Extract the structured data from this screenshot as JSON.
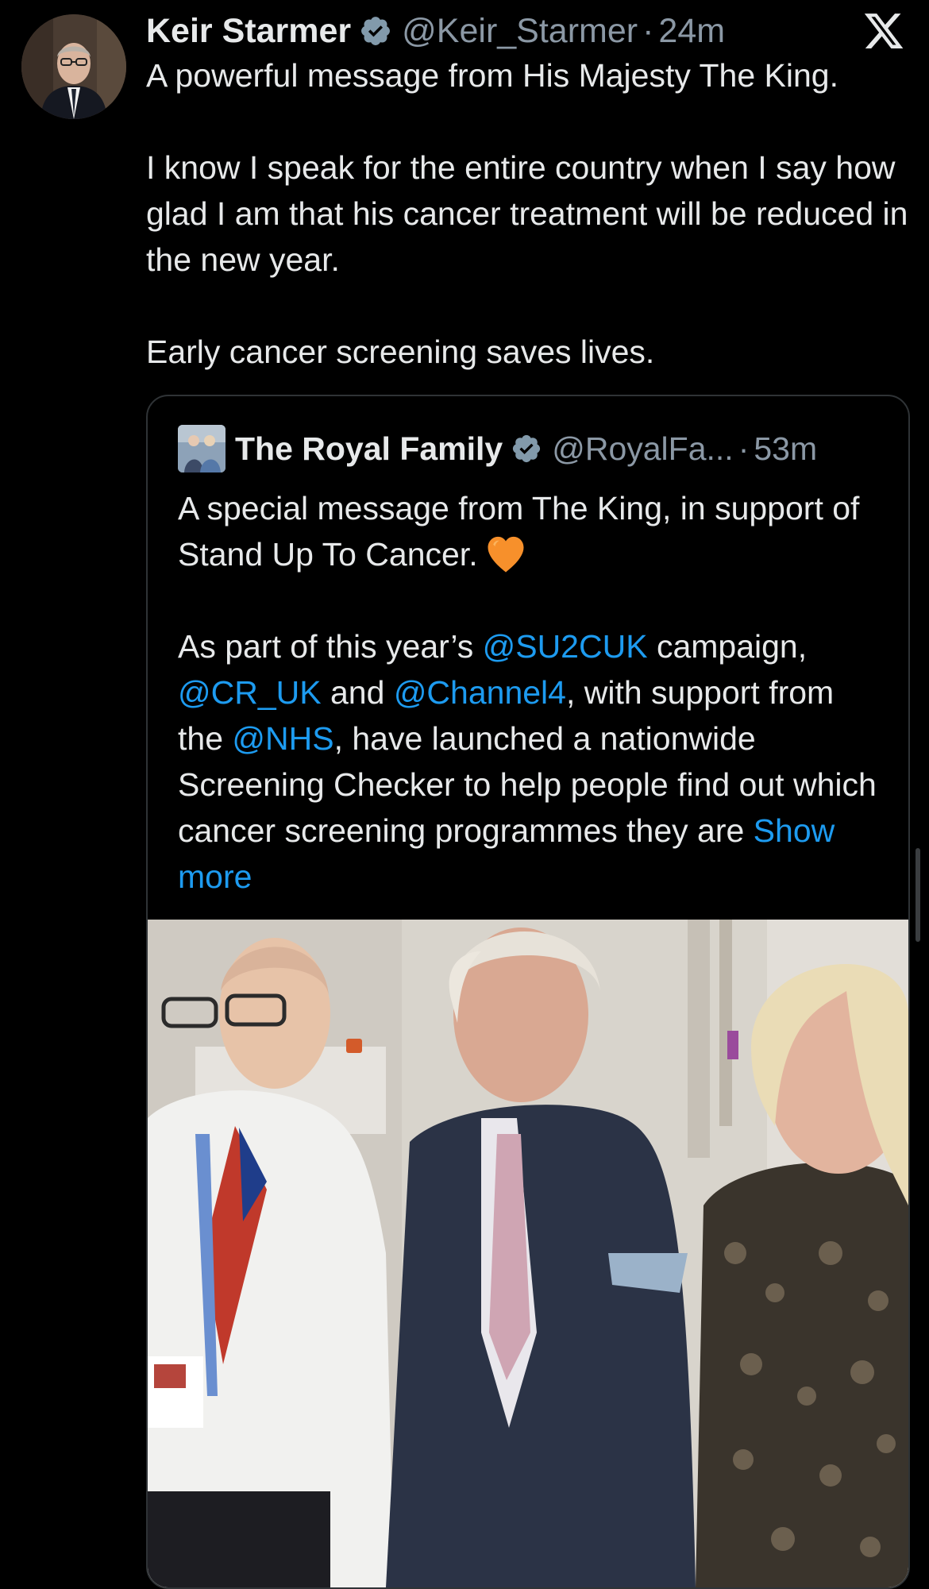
{
  "tweet": {
    "author_name": "Keir Starmer",
    "handle": "@Keir_Starmer",
    "separator": "·",
    "time": "24m",
    "avatar_icon": "portrait-avatar",
    "verified_icon": "verified-badge-icon",
    "logo_icon": "x-logo-icon",
    "text": {
      "para1": "A powerful message from His Majesty The King.",
      "para2": "I know I speak for the entire country when I say how glad I am that his cancer treatment will be reduced in the new year.",
      "para3": "Early cancer screening saves lives."
    }
  },
  "quoted_tweet": {
    "author_name": "The Royal Family",
    "handle": "@RoyalFa...",
    "separator": "·",
    "time": "53m",
    "text": {
      "para1": "A special message from The King, in support of Stand Up To Cancer.",
      "heart_icon": "orange-heart-emoji",
      "p2_part1": "As part of this year’s ",
      "mention1": "@SU2CUK",
      "p2_part2": " campaign, ",
      "mention2": "@CR_UK",
      "p2_part3": " and ",
      "mention3": "@Channel4",
      "p2_part4": ", with support from the ",
      "mention4": "@NHS",
      "p2_part5": ", have launched a nationwide Screening Checker to help people find out which cancer screening programmes they are ",
      "show_more": "Show more"
    },
    "media_description_icon": "video-thumbnail"
  },
  "colors": {
    "background": "#000000",
    "text_primary": "#e7e9ea",
    "text_secondary": "#8b98a5",
    "link": "#1d9bf0",
    "verified": "#829aab",
    "border": "#2f3336",
    "heart": "#f7902b"
  }
}
